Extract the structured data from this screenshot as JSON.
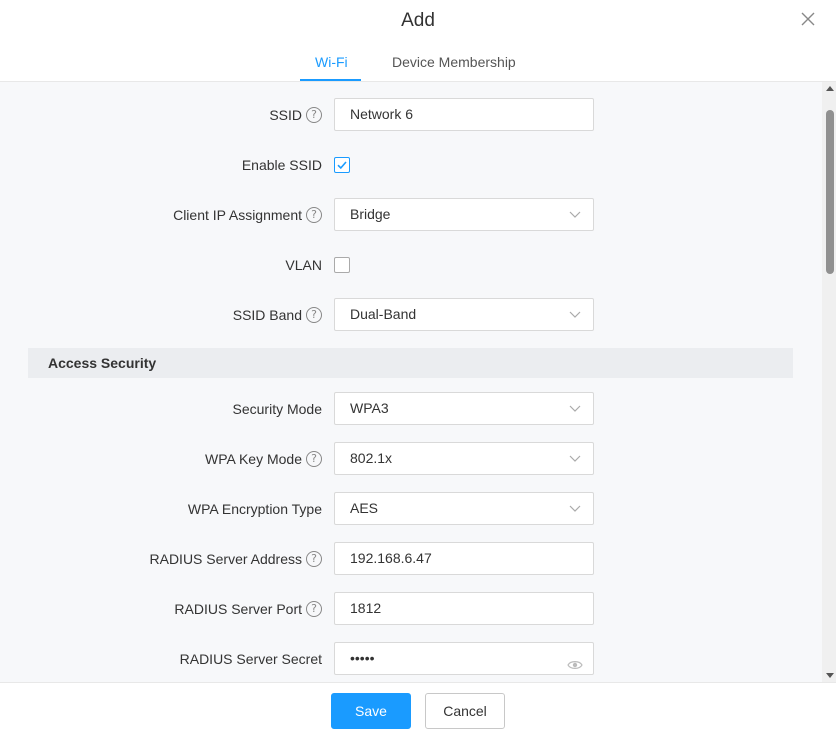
{
  "dialog": {
    "title": "Add"
  },
  "tabs": [
    {
      "label": "Wi-Fi",
      "active": true
    },
    {
      "label": "Device Membership",
      "active": false
    }
  ],
  "form": {
    "ssid": {
      "label": "SSID",
      "value": "Network 6",
      "help": "?"
    },
    "enable_ssid": {
      "label": "Enable SSID",
      "checked": true
    },
    "client_ip_assignment": {
      "label": "Client IP Assignment",
      "value": "Bridge",
      "help": "?"
    },
    "vlan": {
      "label": "VLAN",
      "checked": false
    },
    "ssid_band": {
      "label": "SSID Band",
      "value": "Dual-Band",
      "help": "?"
    },
    "access_security": {
      "title": "Access Security"
    },
    "security_mode": {
      "label": "Security Mode",
      "value": "WPA3"
    },
    "wpa_key_mode": {
      "label": "WPA Key Mode",
      "value": "802.1x",
      "help": "?"
    },
    "wpa_encryption_type": {
      "label": "WPA Encryption Type",
      "value": "AES"
    },
    "radius_server_address": {
      "label": "RADIUS Server Address",
      "value": "192.168.6.47",
      "help": "?"
    },
    "radius_server_port": {
      "label": "RADIUS Server Port",
      "value": "1812",
      "help": "?"
    },
    "radius_server_secret": {
      "label": "RADIUS Server Secret",
      "value": "•••••"
    }
  },
  "footer": {
    "save_label": "Save",
    "cancel_label": "Cancel"
  },
  "colors": {
    "accent": "#1a9bff",
    "content_bg": "#f7f8fa",
    "section_bg": "#ebedf0"
  },
  "icons": {
    "close": "close-icon",
    "help": "help-circle-icon",
    "chevron": "chevron-down-icon",
    "eye": "eye-icon",
    "check": "check-icon"
  }
}
